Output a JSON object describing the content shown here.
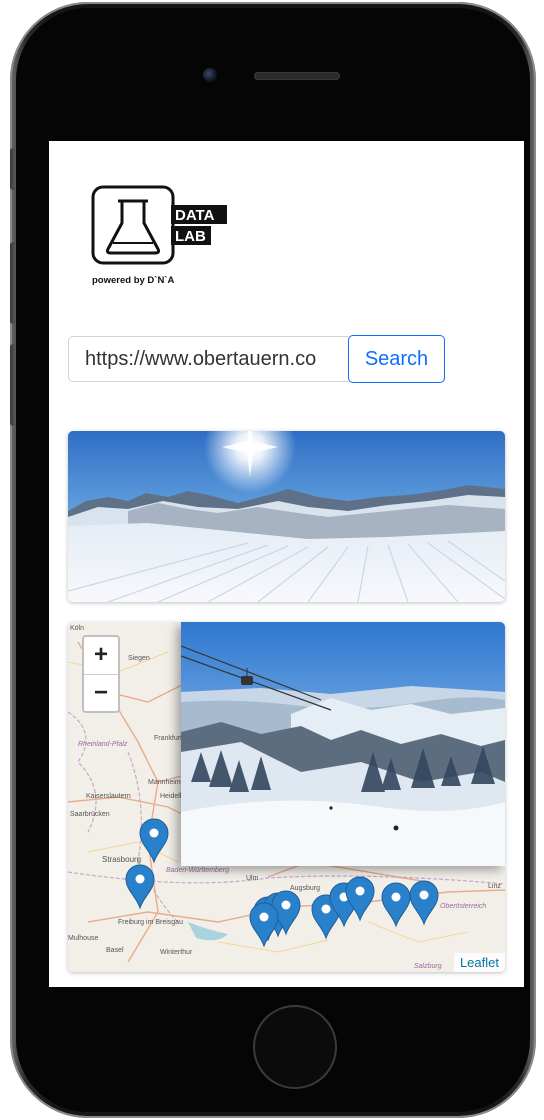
{
  "logo": {
    "line1": "DATA",
    "line2": "LAB",
    "tagline": "powered by D`N`A"
  },
  "search": {
    "url_value": "https://www.obertauern.co",
    "button_label": "Search"
  },
  "map": {
    "zoom_in": "+",
    "zoom_out": "−",
    "attribution": "Leaflet",
    "labels": [
      "Köln",
      "Siegen",
      "Rheinland-Pfalz",
      "Frankfurt",
      "Mannheim",
      "Kaiserslautern",
      "Heidelberg",
      "Saarbrücken",
      "Strasbourg",
      "Freiburg im Breisgau",
      "Mulhouse",
      "Basel",
      "Winterthur",
      "Baden-Württemberg",
      "Ulm",
      "Augsburg",
      "Linz",
      "Oberösterreich",
      "Salzburg"
    ]
  },
  "icons": {
    "flask": "flask-icon",
    "marker": "map-marker-icon"
  },
  "colors": {
    "accent": "#0d6efd",
    "marker": "#2a81cb"
  }
}
